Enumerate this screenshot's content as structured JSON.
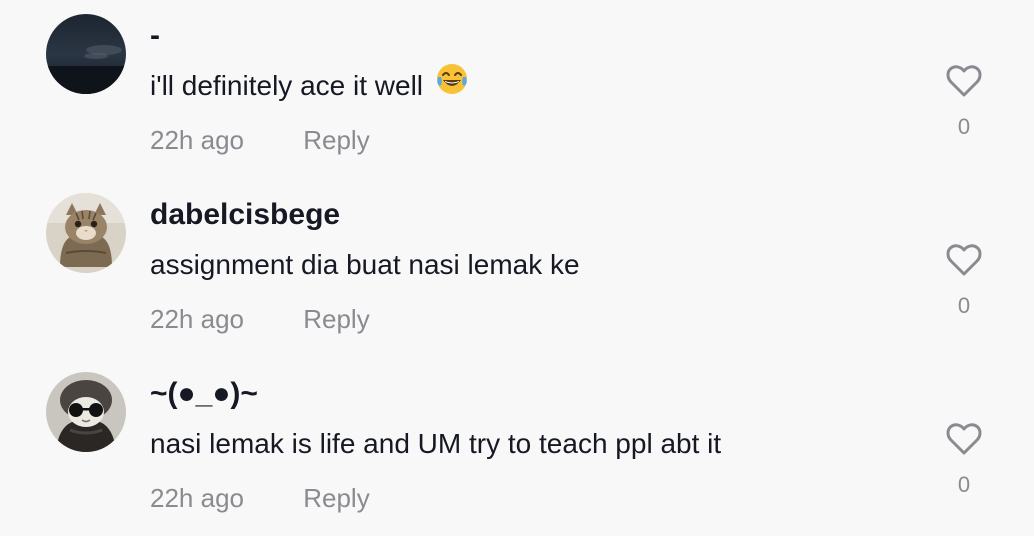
{
  "comments": [
    {
      "username": "-",
      "text": "i'll definitely ace it well",
      "emoji": "face-with-tears-of-joy",
      "time": "22h ago",
      "reply_label": "Reply",
      "likes": "0"
    },
    {
      "username": "dabelcisbege",
      "text": "assignment dia buat nasi lemak ke",
      "time": "22h ago",
      "reply_label": "Reply",
      "likes": "0"
    },
    {
      "username": "~(●_●)~",
      "text": "nasi lemak is life and UM try to teach ppl abt it",
      "time": "22h ago",
      "reply_label": "Reply",
      "likes": "0"
    }
  ],
  "icons": {
    "like": "heart-outline-icon"
  },
  "colors": {
    "background": "#f8f8f8",
    "primary_text": "#161823",
    "secondary_text": "#8a8b91"
  }
}
